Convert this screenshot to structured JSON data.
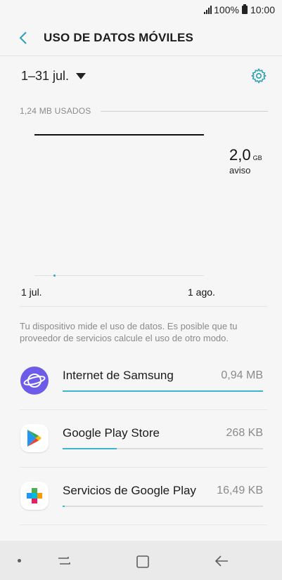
{
  "status_bar": {
    "battery": "100%",
    "time": "10:00"
  },
  "header": {
    "title": "USO DE DATOS MÓVILES"
  },
  "period": {
    "label": "1–31 jul."
  },
  "usage": {
    "used_label": "1,24 MB USADOS"
  },
  "chart": {
    "warning_value": "2,0",
    "warning_unit": "GB",
    "warning_label": "aviso",
    "x_start": "1 jul.",
    "x_end": "1 ago."
  },
  "info_text": "Tu dispositivo mide el uso de datos. Es posible que tu proveedor de servicios calcule el uso de otro modo.",
  "apps": [
    {
      "name": "Internet de Samsung",
      "size": "0,94 MB",
      "usage_fraction": 1.0
    },
    {
      "name": "Google Play Store",
      "size": "268 KB",
      "usage_fraction": 0.27
    },
    {
      "name": "Servicios de Google Play",
      "size": "16,49 KB",
      "usage_fraction": 0.01
    }
  ],
  "colors": {
    "accent": "#3fb4cf",
    "samsung_internet": "#6c5ce7"
  },
  "icons": [
    "back-icon",
    "dropdown-caret-icon",
    "settings-gear-icon",
    "samsung-internet-icon",
    "google-play-store-icon",
    "google-play-services-icon",
    "recents-icon",
    "home-icon",
    "back-nav-icon"
  ]
}
